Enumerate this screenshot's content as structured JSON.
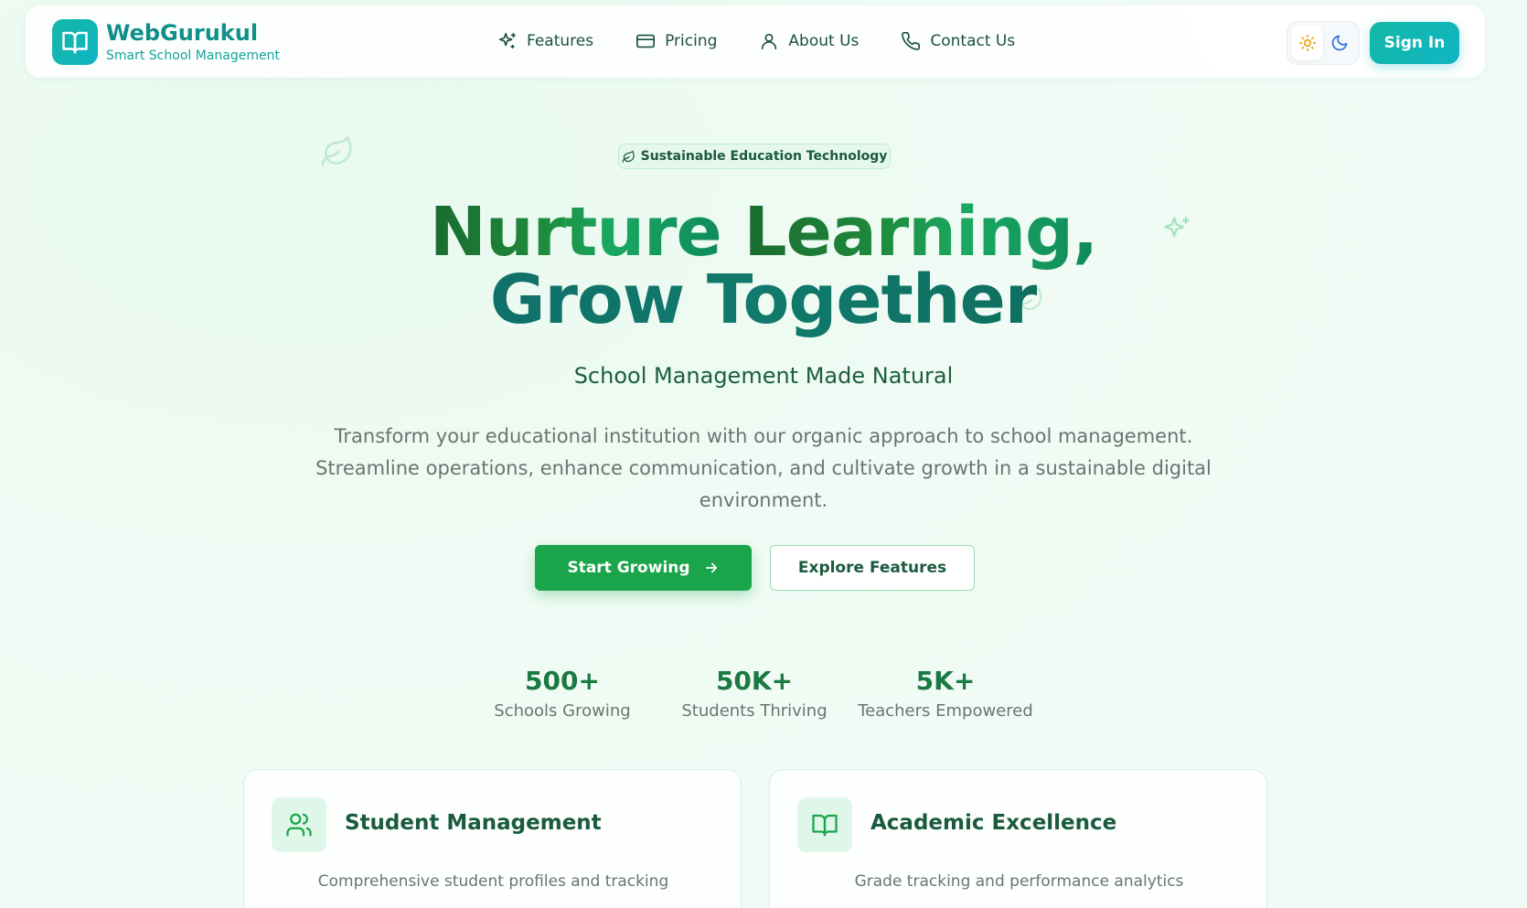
{
  "navbar": {
    "brand_name": "WebGurukul",
    "brand_tagline": "Smart School Management",
    "links": [
      {
        "label": "Features",
        "icon": "sparkles-icon"
      },
      {
        "label": "Pricing",
        "icon": "credit-card-icon"
      },
      {
        "label": "About Us",
        "icon": "user-icon"
      },
      {
        "label": "Contact Us",
        "icon": "phone-icon"
      }
    ],
    "theme_options": [
      "sun-icon",
      "moon-icon"
    ],
    "signin_label": "Sign In"
  },
  "hero": {
    "badge": "Sustainable Education Technology",
    "title_line1_part1": "Nurture",
    "title_line1_part2": "Learning,",
    "title_line2": "Grow Together",
    "subtitle": "School Management Made Natural",
    "description": "Transform your educational institution with our organic approach to school management. Streamline operations, enhance communication, and cultivate growth in a sustainable digital environment.",
    "primary_button": "Start Growing",
    "secondary_button": "Explore Features"
  },
  "stats": [
    {
      "value": "500+",
      "label": "Schools Growing"
    },
    {
      "value": "50K+",
      "label": "Students Thriving"
    },
    {
      "value": "5K+",
      "label": "Teachers Empowered"
    }
  ],
  "features": [
    {
      "title": "Student Management",
      "description": "Comprehensive student profiles and tracking",
      "icon": "users-icon"
    },
    {
      "title": "Academic Excellence",
      "description": "Grade tracking and performance analytics",
      "icon": "book-open-icon"
    }
  ],
  "colors": {
    "brand_teal": "#14b8a6",
    "primary_green": "#1aa54a",
    "heading_green": "#1a7a42",
    "text_muted": "#6a7470"
  }
}
